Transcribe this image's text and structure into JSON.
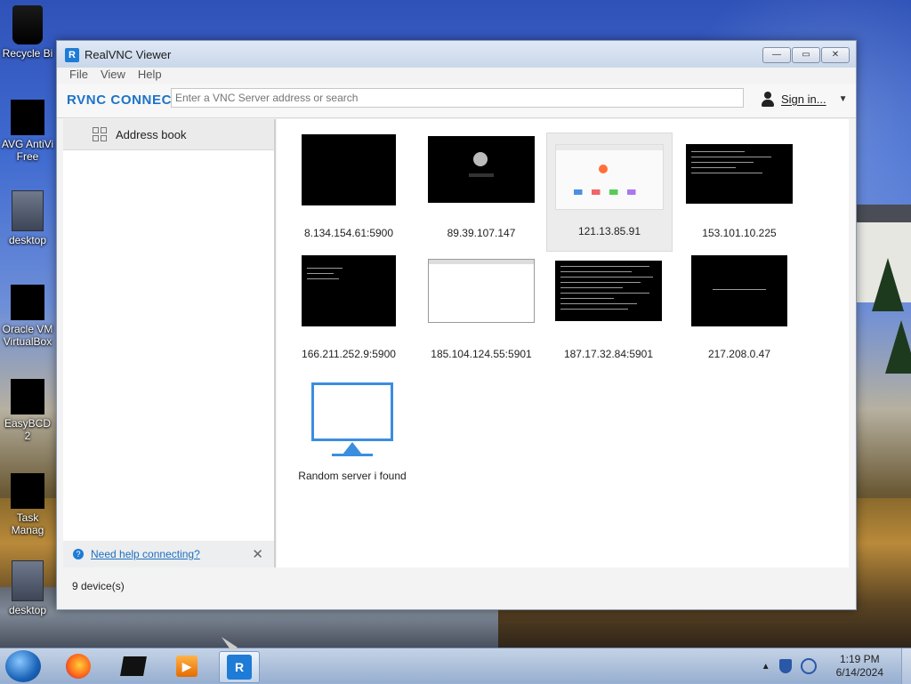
{
  "desktop": {
    "icons": [
      {
        "label": "Recycle Bi",
        "name": "recycle-bin"
      },
      {
        "label": "AVG AntiVi\nFree",
        "name": "avg-antivirus"
      },
      {
        "label": "desktop",
        "name": "desktop-file-1"
      },
      {
        "label": "Oracle VM\nVirtualBox",
        "name": "virtualbox"
      },
      {
        "label": "EasyBCD 2",
        "name": "easybcd"
      },
      {
        "label": "Task Manag",
        "name": "task-manager"
      },
      {
        "label": "desktop",
        "name": "desktop-file-2"
      }
    ]
  },
  "window": {
    "title": "RealVNC Viewer",
    "logo_letter": "R",
    "controls": {
      "minimize": "—",
      "maximize": "▭",
      "close": "✕"
    },
    "menu": [
      "File",
      "View",
      "Help"
    ],
    "brand": "RVNC CONNECT",
    "search_placeholder": "Enter a VNC Server address or search",
    "signin_label": "Sign in...",
    "sidebar": {
      "address_book_label": "Address book",
      "help_link": "Need help connecting?",
      "help_close": "✕"
    },
    "devices": [
      {
        "label": "8.134.154.61:5900",
        "thumb": "black"
      },
      {
        "label": "89.39.107.147",
        "thumb": "black-login"
      },
      {
        "label": "121.13.85.91",
        "thumb": "browser",
        "selected": true
      },
      {
        "label": "153.101.10.225",
        "thumb": "terminal"
      },
      {
        "label": "166.211.252.9:5900",
        "thumb": "terminal-small"
      },
      {
        "label": "185.104.124.55:5901",
        "thumb": "white"
      },
      {
        "label": "187.17.32.84:5901",
        "thumb": "terminal-dense"
      },
      {
        "label": "217.208.0.47",
        "thumb": "black-text"
      },
      {
        "label": "Random server i found",
        "thumb": "monitor-icon"
      }
    ],
    "status": "9 device(s)"
  },
  "taskbar": {
    "time": "1:19 PM",
    "date": "6/14/2024",
    "vnc_letter": "R"
  },
  "colors": {
    "accent": "#1e7bd6",
    "monitor_icon": "#3a8ee0"
  }
}
